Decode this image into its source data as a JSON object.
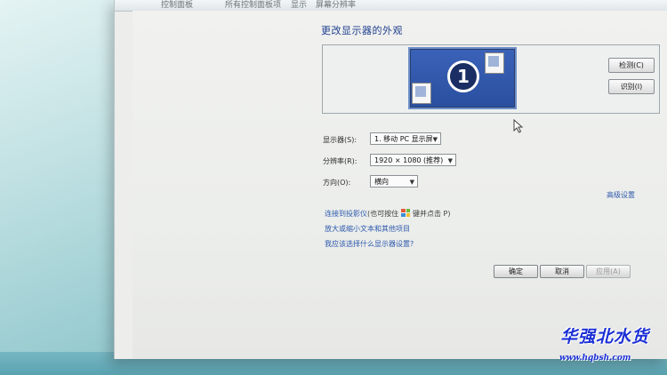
{
  "window": {
    "breadcrumb": [
      "控制面板",
      "所有控制面板项",
      "显示",
      "屏幕分辨率"
    ]
  },
  "heading": "更改显示器的外观",
  "preview": {
    "monitor_number": "1",
    "detect_label": "检测(C)",
    "identify_label": "识别(I)"
  },
  "form": {
    "display_label": "显示器(S):",
    "display_value": "1. 移动 PC 显示屏",
    "resolution_label": "分辨率(R):",
    "resolution_value": "1920 × 1080 (推荐)",
    "orientation_label": "方向(O):",
    "orientation_value": "横向"
  },
  "advanced_link": "高级设置",
  "links": {
    "projector_link": "连接到投影仪",
    "projector_hint_pre": "(也可按住",
    "projector_hint_post": "键并点击 P)",
    "text_size_link": "放大或缩小文本和其他项目",
    "which_settings_link": "我应该选择什么显示器设置?"
  },
  "buttons": {
    "ok": "确定",
    "cancel": "取消",
    "apply": "应用(A)"
  },
  "watermark": {
    "text": "华强北水货",
    "url": "www.hqbsh.com"
  },
  "icons": {
    "dropdown": "chevron-down-icon",
    "windows_key": "windows-logo-icon",
    "cursor": "mouse-pointer-icon"
  }
}
